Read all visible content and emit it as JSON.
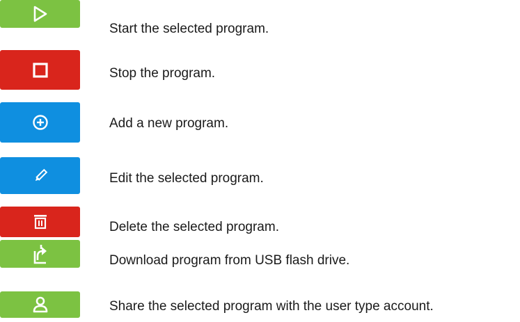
{
  "colors": {
    "green": "#7cc242",
    "red": "#d9251c",
    "blue": "#0f8fe0",
    "icon": "#ffffff"
  },
  "buttons": [
    {
      "icon": "play-triangle-icon",
      "color": "green",
      "description": "Start the selected program."
    },
    {
      "icon": "stop-square-icon",
      "color": "red",
      "description": "Stop the program."
    },
    {
      "icon": "plus-circle-icon",
      "color": "blue",
      "description": "Add a new program."
    },
    {
      "icon": "pencil-icon",
      "color": "blue",
      "description": "Edit the selected program."
    },
    {
      "icon": "trash-icon",
      "color": "red",
      "description": "Delete the selected program."
    },
    {
      "icon": "upload-document-icon",
      "color": "green",
      "description": "Download program from USB flash drive."
    },
    {
      "icon": "user-icon",
      "color": "green",
      "description": "Share the selected program with the user type account."
    }
  ]
}
